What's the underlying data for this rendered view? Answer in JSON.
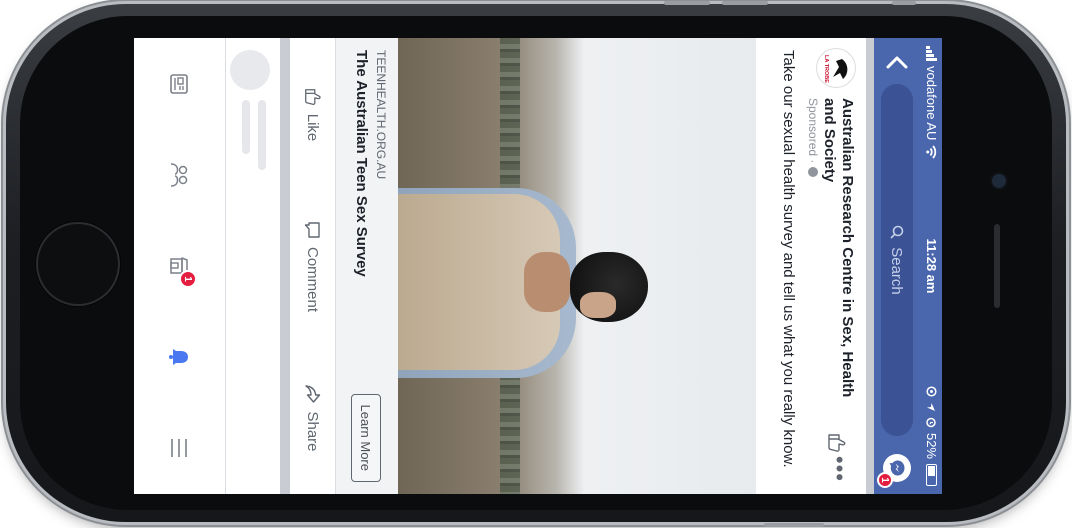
{
  "status_bar": {
    "carrier": "vodafone AU",
    "time": "11:28 am",
    "battery": "52%"
  },
  "nav": {
    "search_placeholder": "Search",
    "messenger_badge": "1"
  },
  "post": {
    "advertiser": "Australian Research Centre in Sex, Health and Society",
    "logo_text": "LA TROBE",
    "sponsored": "Sponsored ·",
    "text": "Take our sexual health survey and tell us what you really know.",
    "link": {
      "domain": "TEENHEALTH.ORG.AU",
      "title": "The Australian Teen Sex Survey",
      "cta": "Learn More"
    },
    "actions": {
      "like": "Like",
      "comment": "Comment",
      "share": "Share"
    }
  },
  "tabbar": {
    "notifications_badge": "1"
  },
  "colors": {
    "brand_blue": "#4a67ad",
    "search_bg": "#3b5294",
    "badge_red": "#e41e3f",
    "active_tab": "#4a78f0",
    "inactive_tab": "#7b8089"
  },
  "icons": {
    "back": "chevron-left-icon",
    "search": "search-icon",
    "messenger": "messenger-icon",
    "like": "thumbs-up-icon",
    "comment": "speech-bubble-icon",
    "share": "share-arrow-icon",
    "tabs": [
      "news-feed-icon",
      "groups-icon",
      "marketplace-icon",
      "notifications-bell-icon",
      "menu-icon"
    ]
  }
}
